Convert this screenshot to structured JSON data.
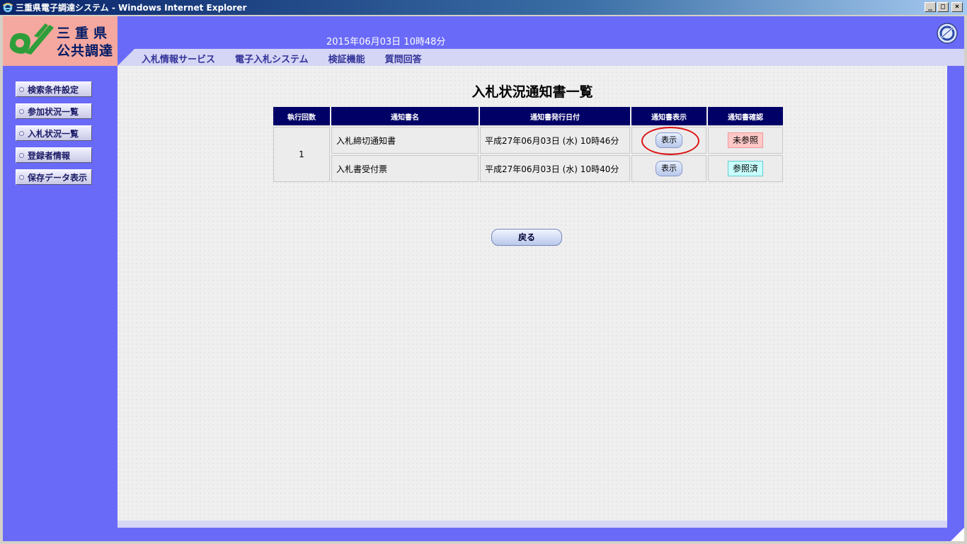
{
  "window": {
    "title": "三重県電子調達システム - Windows Internet Explorer",
    "minimize": "_",
    "maximize": "□",
    "close": "×"
  },
  "logo": {
    "line1": "三重県",
    "line2": "公共調達"
  },
  "header": {
    "datetime": "2015年06月03日 10時48分"
  },
  "nav": [
    {
      "label": "入札情報サービス"
    },
    {
      "label": "電子入札システム"
    },
    {
      "label": "検証機能"
    },
    {
      "label": "質問回答"
    }
  ],
  "sidebar": [
    {
      "label": "検索条件設定"
    },
    {
      "label": "参加状況一覧"
    },
    {
      "label": "入札状況一覧"
    },
    {
      "label": "登録者情報"
    },
    {
      "label": "保存データ表示"
    }
  ],
  "page_title": "入札状況通知書一覧",
  "table": {
    "headers": [
      "執行回数",
      "通知書名",
      "通知書発行日付",
      "通知書表示",
      "通知書確認"
    ],
    "round": "1",
    "rows": [
      {
        "name": "入札締切通知書",
        "date": "平成27年06月03日 (水) 10時46分",
        "show": "表示",
        "status": "未参照"
      },
      {
        "name": "入札書受付票",
        "date": "平成27年06月03日 (水) 10時40分",
        "show": "表示",
        "status": "参照済"
      }
    ]
  },
  "back_button": "戻る",
  "colors": {
    "header": "#6a6af8",
    "nav": "#d5d5f5",
    "table_header": "#000066",
    "unread": "#ffc8c8",
    "read": "#c8ffff",
    "highlight": "#dd1111"
  }
}
